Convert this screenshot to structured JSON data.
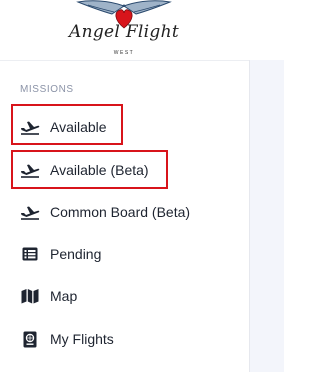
{
  "logo": {
    "text": "Angel Flight",
    "subtext": "WEST"
  },
  "sidebar": {
    "section_label": "MISSIONS",
    "items": [
      {
        "label": "Available",
        "icon": "plane-departure-icon",
        "highlighted": true
      },
      {
        "label": "Available (Beta)",
        "icon": "plane-departure-icon",
        "highlighted": true
      },
      {
        "label": "Common Board (Beta)",
        "icon": "plane-departure-icon",
        "highlighted": false
      },
      {
        "label": "Pending",
        "icon": "list-icon",
        "highlighted": false
      },
      {
        "label": "Map",
        "icon": "map-icon",
        "highlighted": false
      },
      {
        "label": "My Flights",
        "icon": "passport-icon",
        "highlighted": false
      }
    ]
  },
  "colors": {
    "highlight": "#d8141b",
    "text": "#1e2430",
    "section_label": "#8b93a7",
    "main_bg": "#f3f5fb"
  }
}
